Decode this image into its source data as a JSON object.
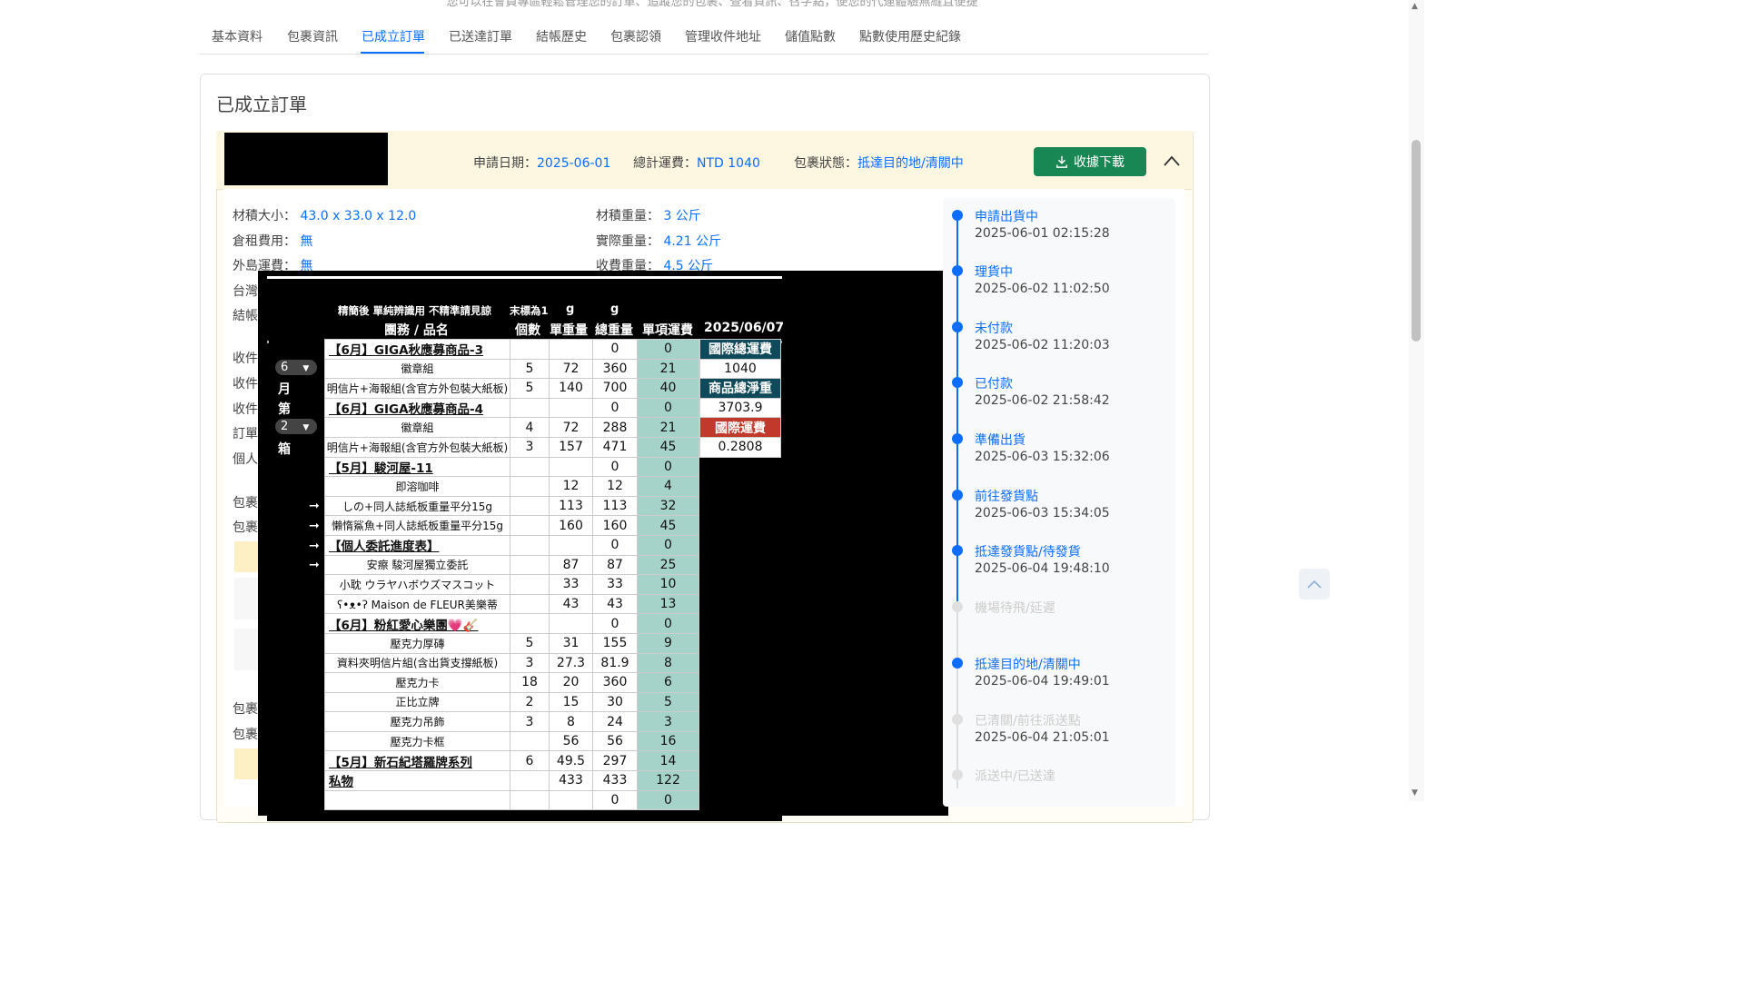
{
  "top_note": "您可以在會員專區輕鬆管理您的訂單、追蹤您的包裹、查看資訊、召字點，便您的代運體驗無縫且便捷",
  "tabs": [
    "基本資料",
    "包裹資訊",
    "已成立訂單",
    "已送達訂單",
    "結帳歷史",
    "包裹認領",
    "管理收件地址",
    "儲值點數",
    "點數使用歷史紀錄"
  ],
  "active_tab": "已成立訂單",
  "card_title": "已成立訂單",
  "order_header": {
    "apply_date_label": "申請日期：",
    "apply_date": "2025-06-01",
    "total_fee_label": "總計運費：",
    "total_fee": "NTD 1040",
    "status_label": "包裹狀態：",
    "status": "抵達目的地/清關中",
    "download_label": "收據下載"
  },
  "info": {
    "volume_label": "材積大小：",
    "volume": "43.0 x 33.0 x 12.0",
    "volume_weight_label": "材積重量：",
    "volume_weight": "3 公斤",
    "storage_label": "倉租費用：",
    "storage": "無",
    "actual_weight_label": "實際重量：",
    "actual_weight": "4.21 公斤",
    "island_label": "外島運費：",
    "island": "無",
    "charge_weight_label": "收費重量：",
    "charge_weight": "4.5 公斤"
  },
  "side_labels": [
    "台灣",
    "結帳",
    "收件",
    "收件",
    "收件",
    "訂單",
    "個人",
    "包裹",
    "包裹",
    "包裹",
    "包裹"
  ],
  "sheet": {
    "note1": "精簡後 單純辨識用 不精準請見諒",
    "note2": "末標為1",
    "g1": "g",
    "g2": "g",
    "col_name": "團務 / 品名",
    "col_qty": "個數",
    "col_unit": "單重量",
    "col_total": "總重量",
    "col_fee": "單項運費",
    "date": "2025/06/07",
    "month_sel": "6",
    "box_sel": "2",
    "side_chars": [
      "月",
      "第",
      "箱"
    ],
    "rows": [
      {
        "g": 1,
        "name": "【6月】GIGA秋應募商品-3",
        "qty": "",
        "unit": "",
        "total": "0",
        "fee": "0"
      },
      {
        "g": 0,
        "name": "徽章組",
        "qty": "5",
        "unit": "72",
        "total": "360",
        "fee": "21"
      },
      {
        "g": 0,
        "name": "明信片+海報組(含官方外包裝大紙板)",
        "qty": "5",
        "unit": "140",
        "total": "700",
        "fee": "40"
      },
      {
        "g": 1,
        "name": "【6月】GIGA秋應募商品-4",
        "qty": "",
        "unit": "",
        "total": "0",
        "fee": "0"
      },
      {
        "g": 0,
        "name": "徽章組",
        "qty": "4",
        "unit": "72",
        "total": "288",
        "fee": "21"
      },
      {
        "g": 0,
        "name": "明信片+海報組(含官方外包裝大紙板)",
        "qty": "3",
        "unit": "157",
        "total": "471",
        "fee": "45"
      },
      {
        "g": 1,
        "name": "【5月】駿河屋-11",
        "qty": "",
        "unit": "",
        "total": "0",
        "fee": "0"
      },
      {
        "g": 0,
        "name": "即溶咖啡",
        "qty": "",
        "unit": "12",
        "total": "12",
        "fee": "4"
      },
      {
        "g": 0,
        "name": "しの+同人誌紙板重量平分15g",
        "qty": "",
        "unit": "113",
        "total": "113",
        "fee": "32"
      },
      {
        "g": 0,
        "name": "懶惰鯊魚+同人誌紙板重量平分15g",
        "qty": "",
        "unit": "160",
        "total": "160",
        "fee": "45"
      },
      {
        "g": 1,
        "name": "【個人委託進度表】",
        "qty": "",
        "unit": "",
        "total": "0",
        "fee": "0"
      },
      {
        "g": 0,
        "name": "安瘵 駿河屋獨立委託",
        "qty": "",
        "unit": "87",
        "total": "87",
        "fee": "25"
      },
      {
        "g": 0,
        "name": "小耽 ウラヤハボウズマスコット",
        "qty": "",
        "unit": "33",
        "total": "33",
        "fee": "10"
      },
      {
        "g": 0,
        "name": "ʕ•ᴥ•ʔ Maison de FLEUR美樂蒂",
        "qty": "",
        "unit": "43",
        "total": "43",
        "fee": "13"
      },
      {
        "g": 1,
        "name": "【6月】粉紅愛心樂團💗🎸",
        "qty": "",
        "unit": "",
        "total": "0",
        "fee": "0"
      },
      {
        "g": 0,
        "name": "壓克力厚磚",
        "qty": "5",
        "unit": "31",
        "total": "155",
        "fee": "9"
      },
      {
        "g": 0,
        "name": "資料夾明信片組(含出貨支撐紙板)",
        "qty": "3",
        "unit": "27.3",
        "total": "81.9",
        "fee": "8"
      },
      {
        "g": 0,
        "name": "壓克力卡",
        "qty": "18",
        "unit": "20",
        "total": "360",
        "fee": "6"
      },
      {
        "g": 0,
        "name": "正比立牌",
        "qty": "2",
        "unit": "15",
        "total": "30",
        "fee": "5"
      },
      {
        "g": 0,
        "name": "壓克力吊飾",
        "qty": "3",
        "unit": "8",
        "total": "24",
        "fee": "3"
      },
      {
        "g": 0,
        "name": "壓克力卡框",
        "qty": "",
        "unit": "56",
        "total": "56",
        "fee": "16"
      },
      {
        "g": 1,
        "name": "【5月】新石紀塔羅牌系列",
        "qty": "6",
        "unit": "49.5",
        "total": "297",
        "fee": "14"
      },
      {
        "g": 1,
        "name": "私物",
        "qty": "",
        "unit": "433",
        "total": "433",
        "fee": "122"
      },
      {
        "g": 0,
        "name": "",
        "qty": "",
        "unit": "",
        "total": "0",
        "fee": "0"
      }
    ],
    "summary": [
      {
        "label": "國際總運費",
        "value": "1040"
      },
      {
        "label": "商品總淨重",
        "value": "3703.9"
      },
      {
        "label": "國際運費",
        "value": "0.2808"
      }
    ]
  },
  "timeline": [
    {
      "title": "申請出貨中",
      "time": "2025-06-01 02:15:28"
    },
    {
      "title": "理貨中",
      "time": "2025-06-02 11:02:50"
    },
    {
      "title": "未付款",
      "time": "2025-06-02 11:20:03"
    },
    {
      "title": "已付款",
      "time": "2025-06-02 21:58:42"
    },
    {
      "title": "準備出貨",
      "time": "2025-06-03 15:32:06"
    },
    {
      "title": "前往發貨點",
      "time": "2025-06-03 15:34:05"
    },
    {
      "title": "抵達發貨點/待發貨",
      "time": "2025-06-04 19:48:10"
    },
    {
      "title": "機場待飛/延遲",
      "time": ""
    },
    {
      "title": "抵達目的地/清關中",
      "time": "2025-06-04 19:49:01"
    },
    {
      "title": "已清關/前往派送點",
      "time": "2025-06-04 21:05:01"
    },
    {
      "title": "派送中/已送達",
      "time": ""
    }
  ],
  "colors": {
    "accent": "#0d6efd",
    "success": "#198754",
    "header_bg": "#fdf6e0",
    "fee_col": "#a5d3c9"
  }
}
